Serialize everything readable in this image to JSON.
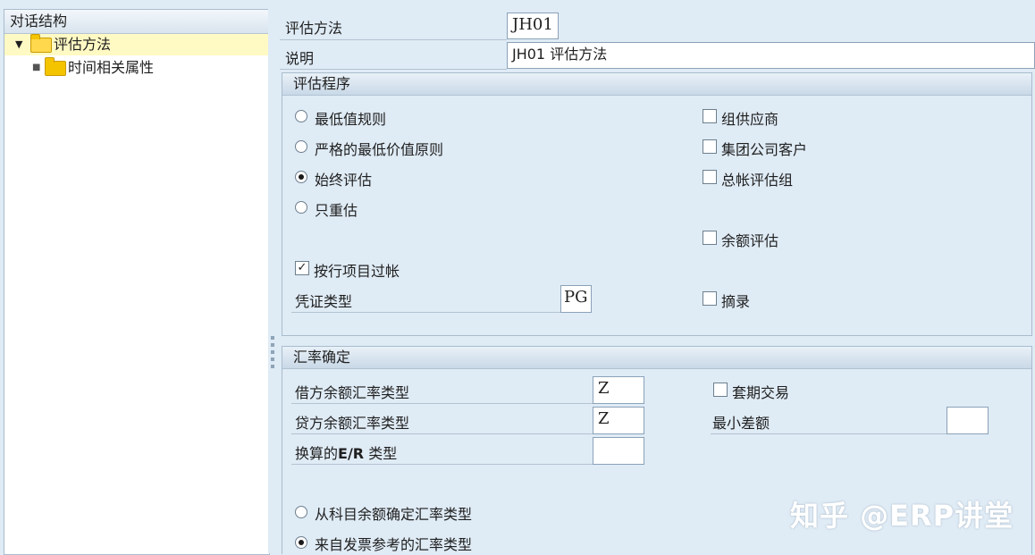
{
  "tree": {
    "header": "对话结构",
    "items": [
      {
        "label": "评估方法",
        "selected": true,
        "expanded": true
      },
      {
        "label": "时间相关属性",
        "selected": false
      }
    ]
  },
  "top_fields": {
    "method_label": "评估方法",
    "method_value": "JH01",
    "desc_label": "说明",
    "desc_value": "JH01 评估方法"
  },
  "procedure": {
    "title": "评估程序",
    "radios": [
      {
        "label": "最低值规则",
        "selected": false
      },
      {
        "label": "严格的最低价值原则",
        "selected": false
      },
      {
        "label": "始终评估",
        "selected": true
      },
      {
        "label": "只重估",
        "selected": false
      }
    ],
    "right_checks": [
      {
        "label": "组供应商",
        "checked": false
      },
      {
        "label": "集团公司客户",
        "checked": false
      },
      {
        "label": "总帐评估组",
        "checked": false
      },
      {
        "label": "余额评估",
        "checked": false
      },
      {
        "label": "摘录",
        "checked": false
      }
    ],
    "post_by_item": {
      "label": "按行项目过帐",
      "checked": true
    },
    "doc_type": {
      "label": "凭证类型",
      "value": "PG"
    }
  },
  "exchange": {
    "title": "汇率确定",
    "debit": {
      "label": "借方余额汇率类型",
      "value": "Z"
    },
    "credit": {
      "label": "贷方余额汇率类型",
      "value": "Z"
    },
    "conv": {
      "label_prefix": "换算的",
      "label_bold": "E/R",
      "label_suffix": " 类型",
      "value": ""
    },
    "hedge": {
      "label": "套期交易",
      "checked": false
    },
    "min_diff": {
      "label": "最小差额",
      "value": ""
    },
    "radios": [
      {
        "label": "从科目余额确定汇率类型",
        "selected": false
      },
      {
        "label": "来自发票参考的汇率类型",
        "selected": true
      }
    ]
  },
  "watermark": "知乎 @ERP讲堂"
}
